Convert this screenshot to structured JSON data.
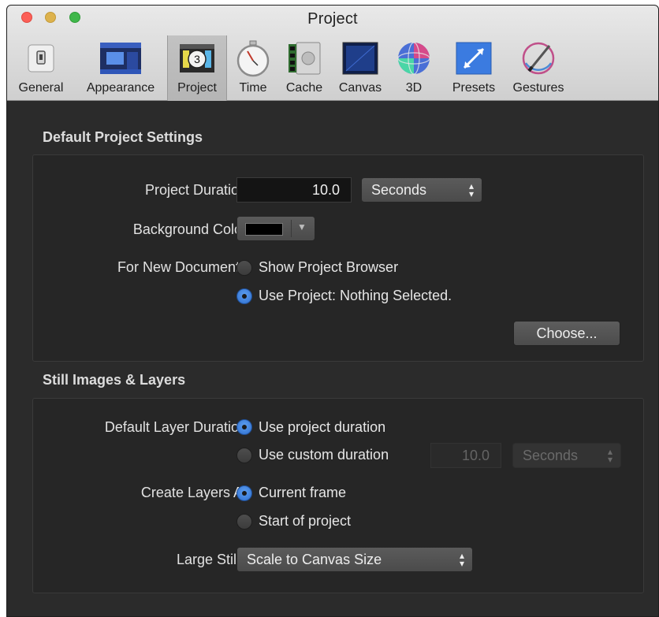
{
  "window": {
    "title": "Project"
  },
  "toolbar": {
    "items": [
      {
        "label": "General",
        "icon": "general-switch-icon"
      },
      {
        "label": "Appearance",
        "icon": "appearance-window-icon"
      },
      {
        "label": "Project",
        "icon": "project-countdown-icon",
        "selected": true
      },
      {
        "label": "Time",
        "icon": "stopwatch-icon"
      },
      {
        "label": "Cache",
        "icon": "memory-cache-icon"
      },
      {
        "label": "Canvas",
        "icon": "canvas-icon"
      },
      {
        "label": "3D",
        "icon": "3d-sphere-icon"
      },
      {
        "label": "Presets",
        "icon": "presets-arrows-icon"
      },
      {
        "label": "Gestures",
        "icon": "gestures-pen-icon"
      }
    ]
  },
  "default_project": {
    "section_title": "Default Project Settings",
    "duration_label": "Project Duration:",
    "duration_value": "10.0",
    "duration_unit": "Seconds",
    "bg_color_label": "Background Color:",
    "bg_color_value": "#000000",
    "new_docs_label": "For New Documents:",
    "option_browser": "Show Project Browser",
    "option_use_project": "Use Project: Nothing Selected.",
    "selected_option": "use_project",
    "choose_button": "Choose..."
  },
  "still_images": {
    "section_title": "Still Images & Layers",
    "layer_duration_label": "Default Layer Duration:",
    "option_project_duration": "Use project duration",
    "option_custom_duration": "Use custom duration",
    "custom_duration_value": "10.0",
    "custom_duration_unit": "Seconds",
    "create_at_label": "Create Layers At:",
    "option_current_frame": "Current frame",
    "option_start_project": "Start of project",
    "large_stills_label": "Large Stills:",
    "large_stills_value": "Scale to Canvas Size"
  },
  "colors": {
    "window_bg": "#2b2b2b",
    "toolbar_bg": "#dcdcdc",
    "radio_selected": "#3a7fe0",
    "text": "#e2e2e2"
  }
}
